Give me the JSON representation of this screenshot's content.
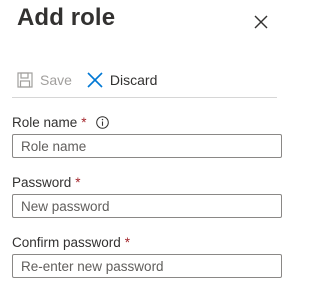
{
  "panel": {
    "title": "Add role"
  },
  "toolbar": {
    "save_label": "Save",
    "discard_label": "Discard",
    "save_icon": "save-icon",
    "discard_icon": "x-icon"
  },
  "form": {
    "role_name": {
      "label": "Role name",
      "required_mark": "*",
      "placeholder": "Role name",
      "value": ""
    },
    "password": {
      "label": "Password",
      "required_mark": "*",
      "placeholder": "New password",
      "value": ""
    },
    "confirm_password": {
      "label": "Confirm password",
      "required_mark": "*",
      "placeholder": "Re-enter new password",
      "value": ""
    }
  },
  "colors": {
    "accent": "#0078d4",
    "required": "#a4262c",
    "disabled": "#a19f9d",
    "text": "#323130"
  }
}
